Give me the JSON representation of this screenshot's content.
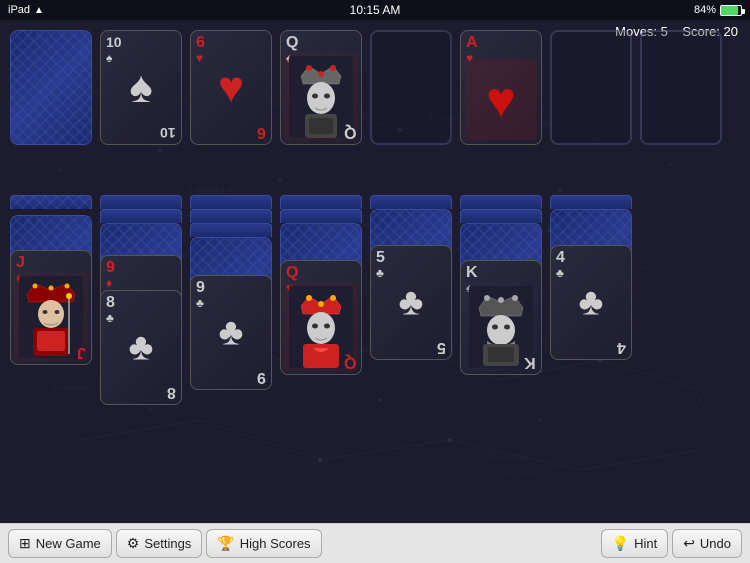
{
  "statusBar": {
    "left": "iPad",
    "time": "10:15 AM",
    "battery": "84%",
    "wifi": true
  },
  "scores": {
    "moves_label": "Moves: 5",
    "score_label": "Score: 20"
  },
  "topRow": {
    "cards": [
      {
        "id": "deck",
        "type": "back",
        "rank": "",
        "suit": ""
      },
      {
        "id": "ten-spades",
        "type": "face",
        "rank": "10",
        "suit": "♠",
        "color": "black"
      },
      {
        "id": "six-hearts",
        "type": "face",
        "rank": "6",
        "suit": "♥",
        "color": "red"
      },
      {
        "id": "queen-spades-top",
        "type": "face-queen",
        "rank": "Q",
        "suit": "♠",
        "color": "black"
      },
      {
        "id": "placeholder1",
        "type": "placeholder"
      },
      {
        "id": "ace-hearts",
        "type": "face-ace",
        "rank": "A",
        "suit": "♥",
        "color": "red"
      },
      {
        "id": "placeholder2",
        "type": "placeholder"
      },
      {
        "id": "placeholder3",
        "type": "placeholder"
      }
    ]
  },
  "bottomRow": {
    "columns": [
      {
        "id": "col1",
        "bottomCard": {
          "rank": "J",
          "suit": "♦",
          "color": "red",
          "type": "face-jack"
        },
        "stacks": 2
      },
      {
        "id": "col2",
        "bottomCard": {
          "rank": "9",
          "suit": "♦",
          "color": "red",
          "type": "face"
        },
        "sub": "8",
        "subSuit": "♣",
        "subColor": "black",
        "stacks": 3
      },
      {
        "id": "col3",
        "bottomCard": {
          "rank": "9",
          "suit": "♣",
          "color": "black",
          "type": "face"
        },
        "stacks": 4
      },
      {
        "id": "col4",
        "bottomCard": {
          "rank": "Q",
          "suit": "♥",
          "color": "red",
          "type": "face-queen"
        },
        "stacks": 3
      },
      {
        "id": "col5",
        "bottomCard": {
          "rank": "5",
          "suit": "♣",
          "color": "black",
          "type": "face"
        },
        "stacks": 2
      },
      {
        "id": "col6",
        "bottomCard": {
          "rank": "K",
          "suit": "♠",
          "color": "black",
          "type": "face-king"
        },
        "stacks": 3
      },
      {
        "id": "col7",
        "bottomCard": {
          "rank": "4",
          "suit": "♣",
          "color": "black",
          "type": "face"
        },
        "stacks": 2
      }
    ]
  },
  "toolbar": {
    "newGame": "New Game",
    "settings": "Settings",
    "highScores": "High Scores",
    "hint": "Hint",
    "undo": "Undo"
  }
}
